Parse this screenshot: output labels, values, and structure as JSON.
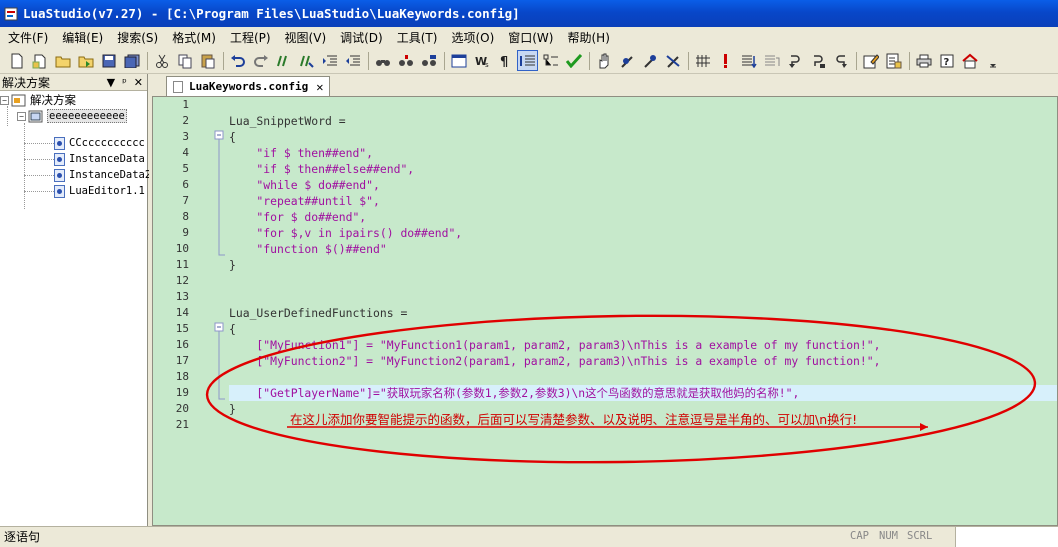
{
  "window": {
    "title": "LuaStudio(v7.27) - [C:\\Program Files\\LuaStudio\\LuaKeywords.config]"
  },
  "menu": [
    "文件(F)",
    "编辑(E)",
    "搜索(S)",
    "格式(M)",
    "工程(P)",
    "视图(V)",
    "调试(D)",
    "工具(T)",
    "选项(O)",
    "窗口(W)",
    "帮助(H)"
  ],
  "panel": {
    "title": "解决方案",
    "controls": {
      "dropdown": "▼",
      "pin": "ᵖ",
      "close": "✕"
    },
    "tree": {
      "root": "解决方案",
      "project": "eeeeeeeeeeee",
      "files": [
        "CCcccccccccc",
        "InstanceData",
        "InstanceData2",
        "LuaEditor1.1"
      ]
    }
  },
  "tab": {
    "label": "LuaKeywords.config",
    "close": "✕"
  },
  "editor": {
    "line_numbers": [
      "1",
      "2",
      "3",
      "4",
      "5",
      "6",
      "7",
      "8",
      "9",
      "10",
      "11",
      "12",
      "13",
      "14",
      "15",
      "16",
      "17",
      "18",
      "19",
      "20",
      "21"
    ],
    "lines": [
      "",
      "Lua_SnippetWord =",
      "{",
      "    \"if $ then##end\",",
      "    \"if $ then##else##end\",",
      "    \"while $ do##end\",",
      "    \"repeat##until $\",",
      "    \"for $ do##end\",",
      "    \"for $,v in ipairs() do##end\",",
      "    \"function $()##end\"",
      "}",
      "",
      "",
      "Lua_UserDefinedFunctions =",
      "{",
      "    [\"MyFunction1\"] = \"MyFunction1(param1, param2, param3)\\nThis is a example of my function!\",",
      "    [\"MyFunction2\"] = \"MyFunction2(param1, param2, param3)\\nThis is a example of my function!\",",
      "",
      "    [\"GetPlayerName\"]=\"获取玩家名称(参数1,参数2,参数3)\\n这个鸟函数的意思就是获取他妈的名称!\",",
      "}",
      ""
    ],
    "current_line": 19,
    "annotation": "在这儿添加你要智能提示的函数，后面可以写清楚参数、以及说明、注意逗号是半角的、可以加\\n换行!"
  },
  "status": {
    "text": "逐语句",
    "indicators": [
      "CAP",
      "NUM",
      "SCRL"
    ]
  },
  "colors": {
    "editor_bg": "#c7e9cb",
    "string": "#a010a0",
    "annotation": "#d00000",
    "title_bar": "#0a5ee8"
  }
}
